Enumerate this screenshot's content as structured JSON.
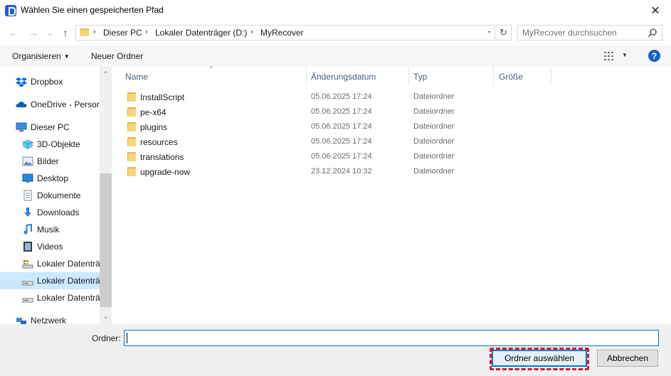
{
  "window": {
    "title": "Wählen Sie einen gespeicherten Pfad",
    "close_glyph": "✕"
  },
  "navigation": {
    "back_glyph": "←",
    "forward_glyph": "→",
    "recent_glyph": "⌄",
    "up_glyph": "↑",
    "breadcrumbs": [
      "Dieser PC",
      "Lokaler Datenträger (D:)",
      "MyRecover"
    ],
    "separator_glyph": "›",
    "dropdown_glyph": "⌄",
    "refresh_glyph": "↻",
    "search_placeholder": "MyRecover durchsuchen"
  },
  "toolbar": {
    "organize_label": "Organisieren",
    "organize_arrow": "▼",
    "new_folder_label": "Neuer Ordner",
    "view_arrow": "▼",
    "help_label": "?"
  },
  "sidebar": {
    "items": [
      {
        "label": "Dropbox",
        "icon": "dropbox-icon",
        "level": 0,
        "state": ""
      },
      {
        "label": "OneDrive - Person",
        "icon": "onedrive-icon",
        "level": 0,
        "state": ""
      },
      {
        "label": "Dieser PC",
        "icon": "computer-icon",
        "level": 0,
        "state": ""
      },
      {
        "label": "3D-Objekte",
        "icon": "3d-objects-icon",
        "level": 1,
        "state": ""
      },
      {
        "label": "Bilder",
        "icon": "pictures-icon",
        "level": 1,
        "state": ""
      },
      {
        "label": "Desktop",
        "icon": "desktop-icon",
        "level": 1,
        "state": ""
      },
      {
        "label": "Dokumente",
        "icon": "documents-icon",
        "level": 1,
        "state": ""
      },
      {
        "label": "Downloads",
        "icon": "downloads-icon",
        "level": 1,
        "state": ""
      },
      {
        "label": "Musik",
        "icon": "music-icon",
        "level": 1,
        "state": ""
      },
      {
        "label": "Videos",
        "icon": "videos-icon",
        "level": 1,
        "state": ""
      },
      {
        "label": "Lokaler Datenträ",
        "icon": "system-drive-icon",
        "level": 1,
        "state": ""
      },
      {
        "label": "Lokaler Datenträ",
        "icon": "drive-icon",
        "level": 1,
        "state": "selected"
      },
      {
        "label": "Lokaler Datenträ",
        "icon": "drive-icon",
        "level": 1,
        "state": ""
      },
      {
        "label": "Netzwerk",
        "icon": "network-icon",
        "level": 0,
        "state": ""
      }
    ],
    "scroll_up_glyph": "⌃",
    "scroll_down_glyph": "⌄"
  },
  "filelist": {
    "columns": {
      "name": "Name",
      "date": "Änderungsdatum",
      "type": "Typ",
      "size": "Größe"
    },
    "sort_glyph": "^",
    "rows": [
      {
        "name": "InstallScript",
        "date": "05.06.2025 17:24",
        "type": "Dateiordner"
      },
      {
        "name": "pe-x64",
        "date": "05.06.2025 17:24",
        "type": "Dateiordner"
      },
      {
        "name": "plugins",
        "date": "05.06.2025 17:24",
        "type": "Dateiordner"
      },
      {
        "name": "resources",
        "date": "05.06.2025 17:24",
        "type": "Dateiordner"
      },
      {
        "name": "translations",
        "date": "05.06.2025 17:24",
        "type": "Dateiordner"
      },
      {
        "name": "upgrade-now",
        "date": "23.12.2024 10:32",
        "type": "Dateiordner"
      }
    ]
  },
  "footer": {
    "folder_label": "Ordner:",
    "folder_value": "",
    "select_button": "Ordner auswählen",
    "cancel_button": "Abbrechen"
  },
  "colors": {
    "accent": "#0078d7",
    "selection": "#cce8ff",
    "highlight": "#e0151b",
    "folder": "#f8d775"
  }
}
